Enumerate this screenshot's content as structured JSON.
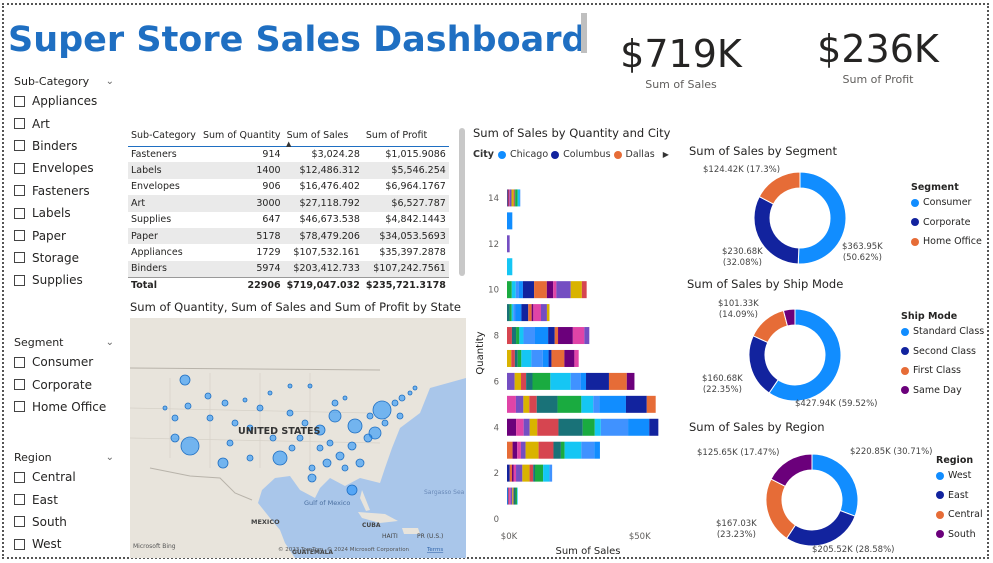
{
  "header": {
    "title": "Super Store Sales Dashboard"
  },
  "kpis": {
    "sales": {
      "value": "$719K",
      "label": "Sum of Sales"
    },
    "profit": {
      "value": "$236K",
      "label": "Sum of Profit"
    }
  },
  "slicers": {
    "subcategory": {
      "title": "Sub-Category",
      "items": [
        "Appliances",
        "Art",
        "Binders",
        "Envelopes",
        "Fasteners",
        "Labels",
        "Paper",
        "Storage",
        "Supplies"
      ]
    },
    "segment": {
      "title": "Segment",
      "items": [
        "Consumer",
        "Corporate",
        "Home Office"
      ]
    },
    "region": {
      "title": "Region",
      "items": [
        "Central",
        "East",
        "South",
        "West"
      ]
    }
  },
  "table": {
    "headers": [
      "Sub-Category",
      "Sum of Quantity",
      "Sum of Sales",
      "Sum of Profit"
    ],
    "rows": [
      [
        "Fasteners",
        "914",
        "$3,024.28",
        "$1,015.9086"
      ],
      [
        "Labels",
        "1400",
        "$12,486.312",
        "$5,546.254"
      ],
      [
        "Envelopes",
        "906",
        "$16,476.402",
        "$6,964.1767"
      ],
      [
        "Art",
        "3000",
        "$27,118.792",
        "$6,527.787"
      ],
      [
        "Supplies",
        "647",
        "$46,673.538",
        "$4,842.1443"
      ],
      [
        "Paper",
        "5178",
        "$78,479.206",
        "$34,053.5693"
      ],
      [
        "Appliances",
        "1729",
        "$107,532.161",
        "$35,397.2878"
      ],
      [
        "Binders",
        "5974",
        "$203,412.733",
        "$107,242.7561"
      ]
    ],
    "total": [
      "Total",
      "22906",
      "$719,047.032",
      "$235,721.3178"
    ]
  },
  "map": {
    "title": "Sum of Quantity, Sum of Sales and Sum of Profit by State",
    "labels": {
      "country": "UNITED STATES",
      "mexico": "MEXICO",
      "gulf": "Gulf of Mexico",
      "cuba": "CUBA",
      "haiti": "HAITI",
      "pr": "PR (U.S.)",
      "guatemala": "GUATEMALA",
      "sea": "Sargasso Sea",
      "bing": "Microsoft Bing",
      "copyright": "© 2023 TomTom, © 2024 Microsoft Corporation",
      "terms": "Terms"
    }
  },
  "bar_visual": {
    "title": "Sum of Sales by Quantity and City",
    "legend_title": "City",
    "legend": [
      {
        "name": "Chicago",
        "color": "#118dff"
      },
      {
        "name": "Columbus",
        "color": "#12239e"
      },
      {
        "name": "Dallas",
        "color": "#e66c37"
      }
    ]
  },
  "donut_segment": {
    "title": "Sum of Sales by Segment",
    "legend_title": "Segment",
    "labels": {
      "consumer": "$363.95K\n(50.62%)",
      "corporate": "$230.68K\n(32.08%)",
      "homeoffice": "$124.42K (17.3%)"
    }
  },
  "donut_ship": {
    "title": "Sum of Sales by Ship Mode",
    "legend_title": "Ship Mode",
    "labels": {
      "standard": "$427.94K (59.52%)",
      "second": "$160.68K\n(22.35%)",
      "first": "$101.33K\n(14.09%)"
    }
  },
  "donut_region": {
    "title": "Sum of Sales by Region",
    "legend_title": "Region",
    "labels": {
      "west": "$220.85K (30.71%)",
      "east": "$205.52K (28.58%)",
      "central": "$167.03K\n(23.23%)",
      "south": "$125.65K (17.47%)"
    }
  },
  "chart_data": [
    {
      "type": "bar",
      "title": "Sum of Sales by Quantity and City",
      "orientation": "horizontal-stacked",
      "xlabel": "Sum of Sales",
      "ylabel": "Quantity",
      "xticks": [
        "$0K",
        "$50K"
      ],
      "yticks": [
        0,
        2,
        4,
        6,
        8,
        10,
        12,
        14
      ],
      "xlim": [
        0,
        58000
      ],
      "ylim": [
        0,
        15
      ],
      "legend_title": "City",
      "categories": [
        1,
        2,
        3,
        4,
        5,
        6,
        7,
        8,
        9,
        10,
        11,
        12,
        13,
        14
      ],
      "totals": [
        4000,
        17000,
        35000,
        57000,
        56000,
        48000,
        27000,
        31000,
        16000,
        30000,
        2000,
        1000,
        2000,
        5000
      ]
    },
    {
      "type": "pie",
      "title": "Sum of Sales by Segment",
      "legend_title": "Segment",
      "categories": [
        "Consumer",
        "Corporate",
        "Home Office"
      ],
      "values": [
        363950,
        230680,
        124420
      ],
      "percent": [
        50.62,
        32.08,
        17.3
      ],
      "colors": [
        "#118dff",
        "#12239e",
        "#e66c37"
      ]
    },
    {
      "type": "pie",
      "title": "Sum of Sales by Ship Mode",
      "legend_title": "Ship Mode",
      "categories": [
        "Standard Class",
        "Second Class",
        "First Class",
        "Same Day"
      ],
      "values": [
        427940,
        160680,
        101330,
        29100
      ],
      "percent": [
        59.52,
        22.35,
        14.09,
        4.04
      ],
      "colors": [
        "#118dff",
        "#12239e",
        "#e66c37",
        "#6b007b"
      ]
    },
    {
      "type": "pie",
      "title": "Sum of Sales by Region",
      "legend_title": "Region",
      "categories": [
        "West",
        "East",
        "Central",
        "South"
      ],
      "values": [
        220850,
        205520,
        167030,
        125650
      ],
      "percent": [
        30.71,
        28.58,
        23.23,
        17.47
      ],
      "colors": [
        "#118dff",
        "#12239e",
        "#e66c37",
        "#6b007b"
      ]
    }
  ]
}
